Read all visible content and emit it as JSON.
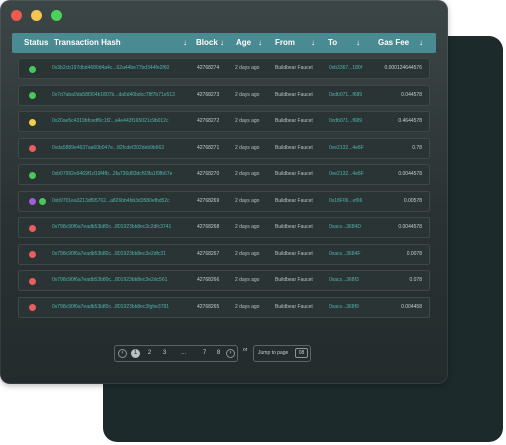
{
  "window": {
    "controls": [
      "close",
      "minimize",
      "maximize"
    ]
  },
  "table": {
    "columns": {
      "status": "Status",
      "hash": "Transaction Hash",
      "block": "Block",
      "age": "Age",
      "from": "From",
      "to": "To",
      "fee": "Gas Fee"
    },
    "rows": [
      {
        "status": [
          "#48c75a"
        ],
        "hash": "0x3b2cb197dbd4680d4a4c...62a44be77bd344fe2f60",
        "block": "42768274",
        "age": "2 days ago",
        "from": "Buildbear Faucet",
        "to": "0xb3367...180f",
        "fee": "0.000124644576"
      },
      {
        "status": [
          "#48c75a"
        ],
        "hash": "0x7d7aba0da58f304b1807b...da5d40bdcc78f7b71e513",
        "block": "42768273",
        "age": "2 days ago",
        "from": "Buildbear Faucet",
        "to": "0xdb071...f689",
        "fee": "0.044578"
      },
      {
        "status": [
          "#f2cf4a"
        ],
        "hash": "0x20ae5c4319bfcedf6c1f2...a4e443f165021c9b012c",
        "block": "42768272",
        "age": "2 days ago",
        "from": "Buildbear Faucet",
        "to": "0xdb071...f689",
        "fee": "0.4644578"
      },
      {
        "status": [
          "#e85d5d"
        ],
        "hash": "0xda5889e4637aa60b047e...82fcdef202deb9b663",
        "block": "42768271",
        "age": "2 days ago",
        "from": "Buildbear Faucet",
        "to": "0xe2132...4e8F",
        "fee": "0.78"
      },
      {
        "status": [
          "#48c75a"
        ],
        "hash": "0xb07992e9469f1d19f4fb...2fa736d83dcf93fa1f9fb67e",
        "block": "42768270",
        "age": "2 days ago",
        "from": "Buildbear Faucet",
        "to": "0xe2132...4e8F",
        "fee": "0.0044578"
      },
      {
        "status": [
          "#a15ed6",
          "#48c75a"
        ],
        "hash": "0xb9701ea3213df95762...a826bb4bb3d3580efbd52c",
        "block": "42768269",
        "age": "2 days ago",
        "from": "Buildbear Faucet",
        "to": "0x18F06...ef06",
        "fee": "0.00578"
      },
      {
        "status": [
          "#e85d5d"
        ],
        "hash": "0x798c90f6a7eadb53b80c...801923bb8ec3c2dfc3741",
        "block": "42768268",
        "age": "2 days ago",
        "from": "Buildbear Faucet",
        "to": "0xacs...3684D",
        "fee": "0.0044578"
      },
      {
        "status": [
          "#e85d5d"
        ],
        "hash": "0x798c90f6a7eadb53b80c...801923bb8ec3e2dfc31",
        "block": "42768267",
        "age": "2 days ago",
        "from": "Buildbear Faucet",
        "to": "0xacs...3684F",
        "fee": "0.0078"
      },
      {
        "status": [
          "#e85d5d"
        ],
        "hash": "0x798c90f6a7eadb53b80c...801923bb8ec3e2dc561",
        "block": "42768266",
        "age": "2 days ago",
        "from": "Buildbear Faucet",
        "to": "0xacs...368f3",
        "fee": "0.078"
      },
      {
        "status": [
          "#e85d5d"
        ],
        "hash": "0x798c90f6a7eadb53b80c...801923bb8ec3fghe3781",
        "block": "42768265",
        "age": "2 days ago",
        "from": "Buildbear Faucet",
        "to": "0xacs...368f9",
        "fee": "0.004458"
      }
    ]
  },
  "pagination": {
    "prev": "‹",
    "next": "›",
    "pages": [
      "1",
      "2",
      "3",
      "...",
      "7",
      "8"
    ],
    "active_page": "1",
    "or_label": "or",
    "jump_label": "Jump to page",
    "jump_value": "08"
  }
}
